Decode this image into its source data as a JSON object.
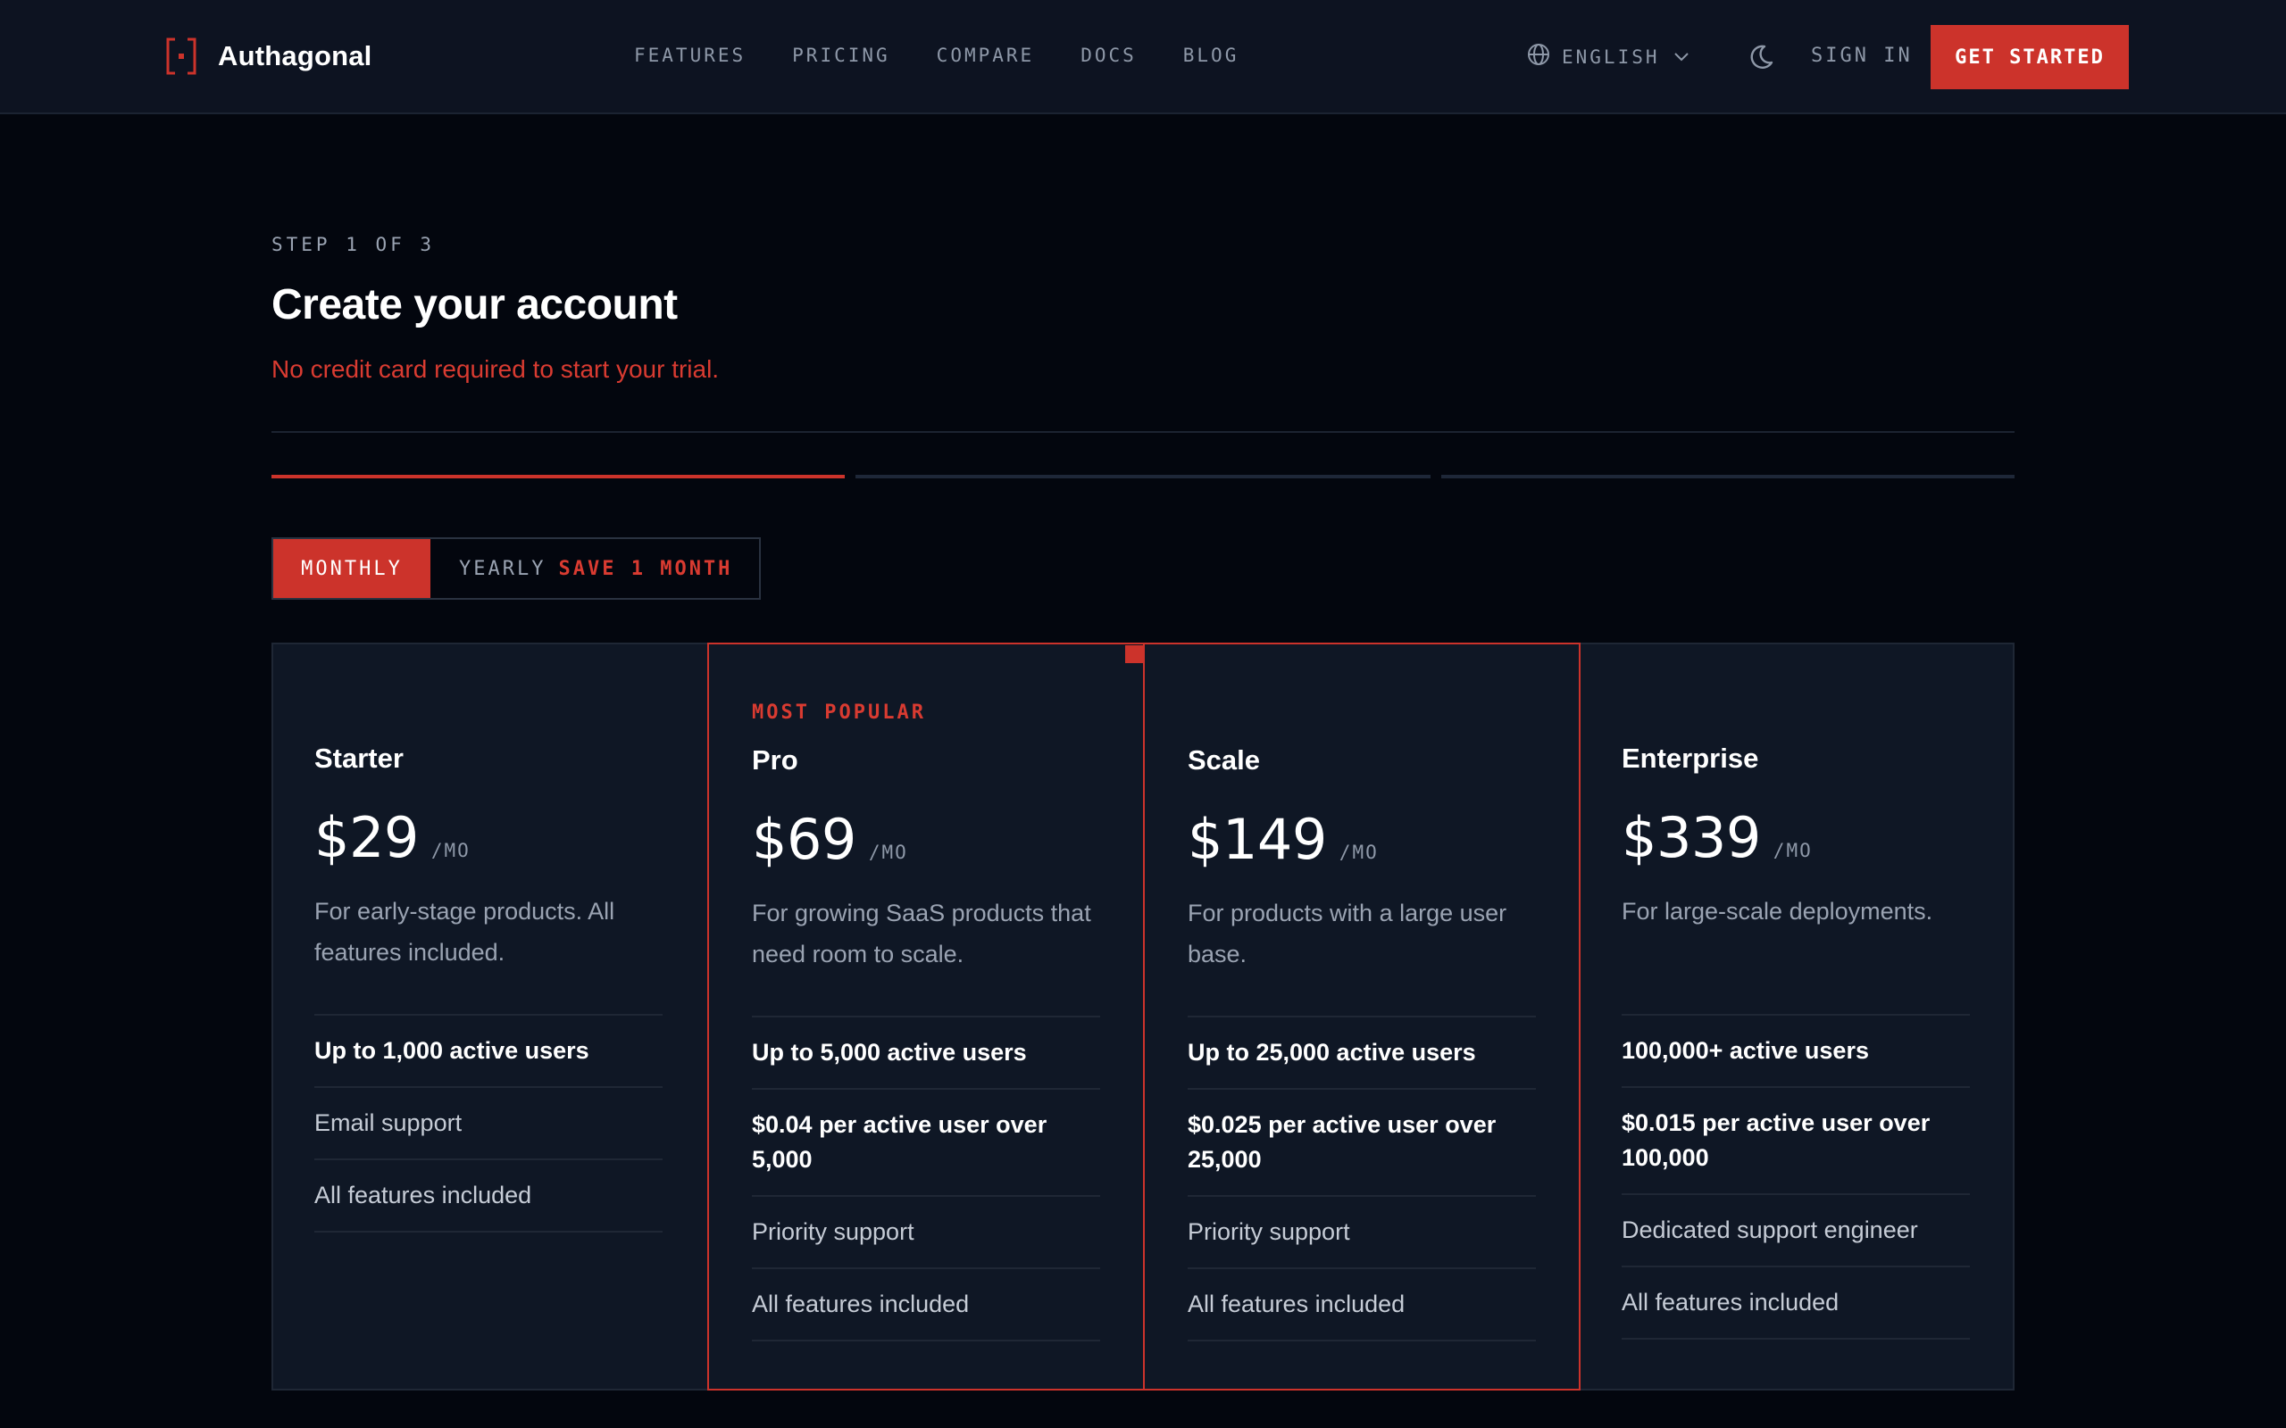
{
  "header": {
    "brand": "Authagonal",
    "nav": [
      "FEATURES",
      "PRICING",
      "COMPARE",
      "DOCS",
      "BLOG"
    ],
    "language": "ENGLISH",
    "sign_in": "SIGN IN",
    "get_started": "GET STARTED"
  },
  "main": {
    "step": "STEP 1 OF 3",
    "title": "Create your account",
    "subtitle": "No credit card required to start your trial.",
    "billing": {
      "monthly": "MONTHLY",
      "yearly": "YEARLY",
      "yearly_badge": "SAVE 1 MONTH",
      "selected": "MONTHLY"
    }
  },
  "plans": [
    {
      "name": "Starter",
      "price": "$29",
      "period": "/MO",
      "description": "For early-stage products. All features included.",
      "features": [
        "Up to 1,000 active users",
        "Email support",
        "All features included"
      ]
    },
    {
      "badge": "MOST POPULAR",
      "name": "Pro",
      "price": "$69",
      "period": "/MO",
      "description": "For growing SaaS products that need room to scale.",
      "features": [
        "Up to 5,000 active users",
        "$0.04 per active user over 5,000",
        "Priority support",
        "All features included"
      ]
    },
    {
      "name": "Scale",
      "price": "$149",
      "period": "/MO",
      "description": "For products with a large user base.",
      "features": [
        "Up to 25,000 active users",
        "$0.025 per active user over 25,000",
        "Priority support",
        "All features included"
      ]
    },
    {
      "name": "Enterprise",
      "price": "$339",
      "period": "/MO",
      "description": "For large-scale deployments.",
      "features": [
        "100,000+ active users",
        "$0.015 per active user over 100,000",
        "Dedicated support engineer",
        "All features included"
      ]
    }
  ],
  "colors": {
    "accent": "#cc332b",
    "background": "#03060e",
    "card": "#0f1725"
  }
}
